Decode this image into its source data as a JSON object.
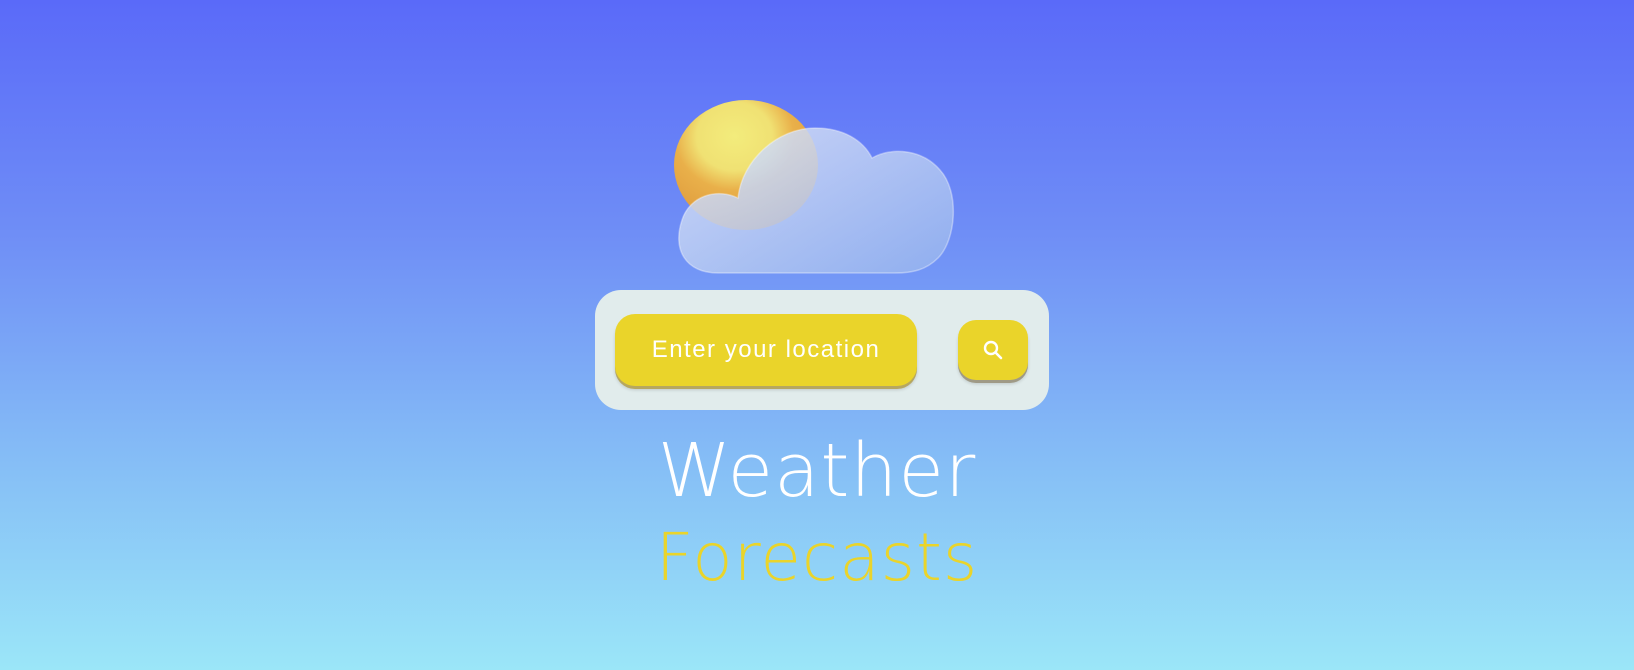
{
  "search": {
    "placeholder": "Enter your location",
    "button_icon": "search-icon"
  },
  "hero": {
    "icon": "partly-cloudy-icon",
    "title": "Weather",
    "subtitle": "Forecasts"
  },
  "colors": {
    "accent_yellow": "#ead42a",
    "panel_bg": "#e1ecec",
    "gradient_top": "#5a6af9",
    "gradient_bottom": "#9be6f8",
    "title_text": "#ffffff"
  }
}
